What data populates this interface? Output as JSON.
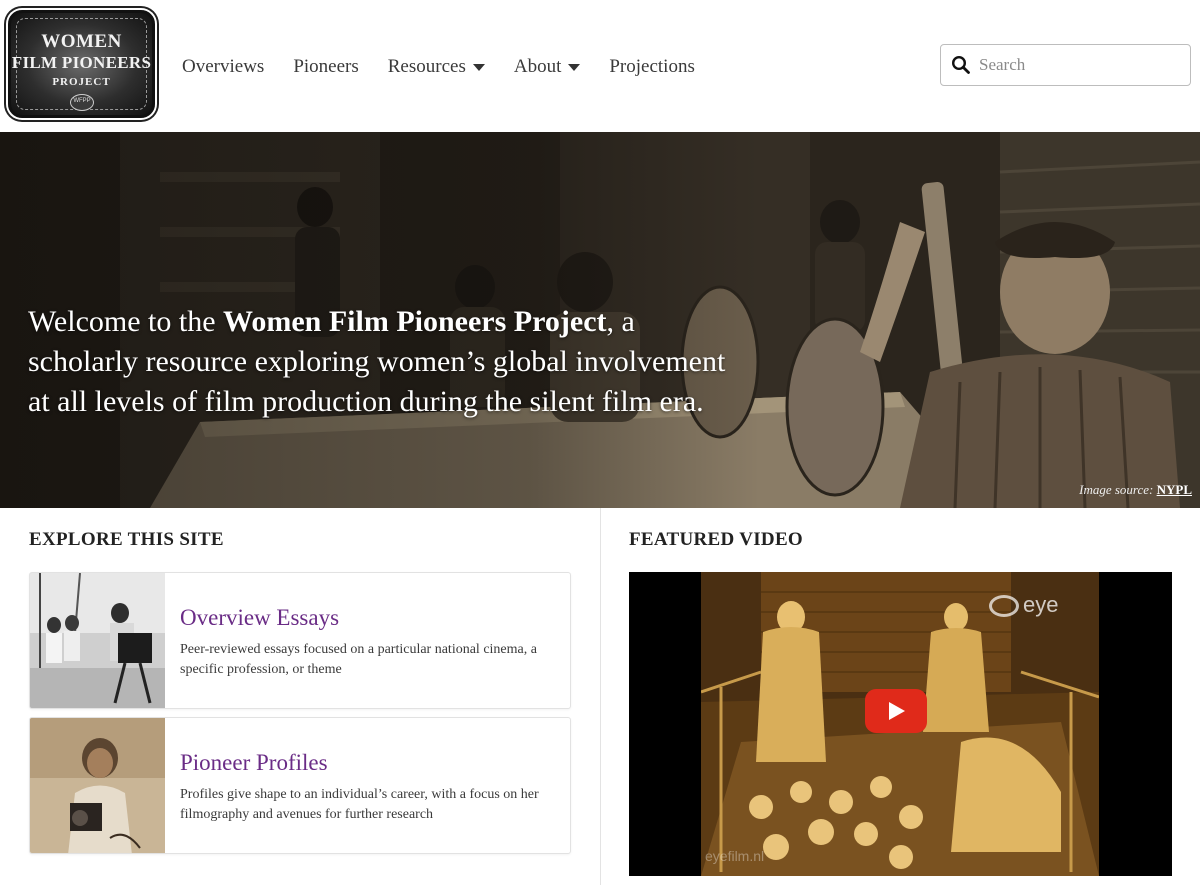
{
  "logo": {
    "line1": "WOMEN",
    "line2": "FILM PIONEERS",
    "line3": "PROJECT",
    "seal": "WFPP"
  },
  "nav": {
    "items": [
      {
        "label": "Overviews",
        "dropdown": false
      },
      {
        "label": "Pioneers",
        "dropdown": false
      },
      {
        "label": "Resources",
        "dropdown": true
      },
      {
        "label": "About",
        "dropdown": true
      },
      {
        "label": "Projections",
        "dropdown": false
      }
    ]
  },
  "search": {
    "placeholder": "Search",
    "icon": "search-icon"
  },
  "hero": {
    "welcome_prefix": "Welcome to the ",
    "welcome_bold": "Women Film Pioneers Project",
    "welcome_suffix": ", a scholarly resource exploring women’s global involvement at all levels of film production during the silent film era.",
    "source_label": "Image source: ",
    "source_link": "NYPL"
  },
  "explore": {
    "heading": "EXPLORE THIS SITE",
    "cards": [
      {
        "title": "Overview Essays",
        "description": "Peer-reviewed essays focused on a particular national cinema, a specific profession, or theme"
      },
      {
        "title": "Pioneer Profiles",
        "description": "Profiles give shape to an individual’s career, with a focus on her filmography and avenues for further research"
      }
    ]
  },
  "featured": {
    "heading": "FEATURED VIDEO",
    "video_logo": "eye",
    "watermark": "eyefilm.nl"
  },
  "colors": {
    "accent_purple": "#6a2c86",
    "play_red": "#e02a1a",
    "text_dark": "#333333"
  }
}
